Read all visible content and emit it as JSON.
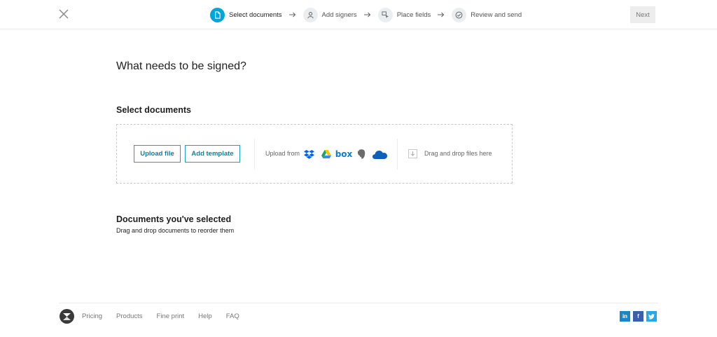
{
  "header": {
    "steps": [
      {
        "label": "Select documents",
        "icon": "document-icon",
        "active": true
      },
      {
        "label": "Add signers",
        "icon": "person-icon",
        "active": false
      },
      {
        "label": "Place fields",
        "icon": "cursor-box-icon",
        "active": false
      },
      {
        "label": "Review and send",
        "icon": "check-circle-icon",
        "active": false
      }
    ],
    "next_label": "Next"
  },
  "main": {
    "title": "What needs to be signed?",
    "select_section": {
      "title": "Select documents",
      "upload_file_label": "Upload file",
      "add_template_label": "Add template",
      "upload_from_label": "Upload from",
      "services": [
        "dropbox-icon",
        "google-drive-icon",
        "box-icon",
        "evernote-icon",
        "onedrive-icon"
      ],
      "box_text": "box",
      "drag_drop_label": "Drag and drop files here"
    },
    "selected_section": {
      "title": "Documents you've selected",
      "subtitle": "Drag and drop documents to reorder them"
    }
  },
  "footer": {
    "links": [
      "Pricing",
      "Products",
      "Fine print",
      "Help",
      "FAQ"
    ],
    "social": [
      {
        "label": "in",
        "name": "linkedin-icon",
        "color": "#1b86c7"
      },
      {
        "label": "f",
        "name": "facebook-icon",
        "color": "#3b5fa8"
      },
      {
        "label": "t",
        "name": "twitter-icon",
        "color": "#27a9e6"
      }
    ]
  },
  "colors": {
    "accent": "#00a5d9",
    "button_border": "#1aa2c4",
    "dropbox": "#0061fe",
    "onedrive": "#0d5fb8"
  }
}
